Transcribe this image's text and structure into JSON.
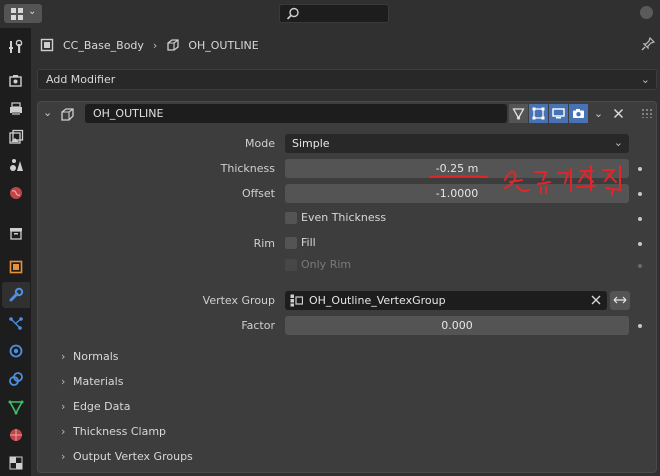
{
  "header": {
    "search_placeholder": ""
  },
  "sidebar": {
    "tabs": [
      {
        "name": "tool-tab"
      },
      {
        "name": "render-tab"
      },
      {
        "name": "output-tab"
      },
      {
        "name": "view-layer-tab"
      },
      {
        "name": "scene-tab"
      },
      {
        "name": "world-tab"
      },
      {
        "name": "collection-tab"
      },
      {
        "name": "object-tab"
      },
      {
        "name": "modifiers-tab"
      },
      {
        "name": "particles-tab"
      },
      {
        "name": "physics-tab"
      },
      {
        "name": "constraints-tab"
      },
      {
        "name": "data-tab"
      },
      {
        "name": "material-tab"
      },
      {
        "name": "texture-tab"
      }
    ],
    "active": "modifiers-tab"
  },
  "breadcrumb": {
    "object": "CC_Base_Body",
    "mesh": "OH_OUTLINE"
  },
  "add_modifier": {
    "label": "Add Modifier"
  },
  "modifier": {
    "name": "OH_OUTLINE",
    "mode": {
      "label": "Mode",
      "value": "Simple"
    },
    "thickness": {
      "label": "Thickness",
      "value": "-0.25 m"
    },
    "offset": {
      "label": "Offset",
      "value": "-1.0000"
    },
    "even_thickness": {
      "label": "Even Thickness",
      "checked": false
    },
    "rim": {
      "label": "Rim",
      "fill_label": "Fill",
      "fill_checked": false,
      "only_rim_label": "Only Rim",
      "only_rim_checked": false
    },
    "vertex_group": {
      "label": "Vertex Group",
      "value": "OH_Outline_VertexGroup"
    },
    "factor": {
      "label": "Factor",
      "value": "0.000"
    },
    "subpanels": [
      "Normals",
      "Materials",
      "Edge Data",
      "Thickness Clamp",
      "Output Vertex Groups"
    ]
  },
  "annotation": {
    "color": "#e0262b",
    "text": "선굵기조절"
  },
  "colors": {
    "accent": "#4772b3",
    "background": "#303030",
    "panel": "#3d3d3d"
  }
}
